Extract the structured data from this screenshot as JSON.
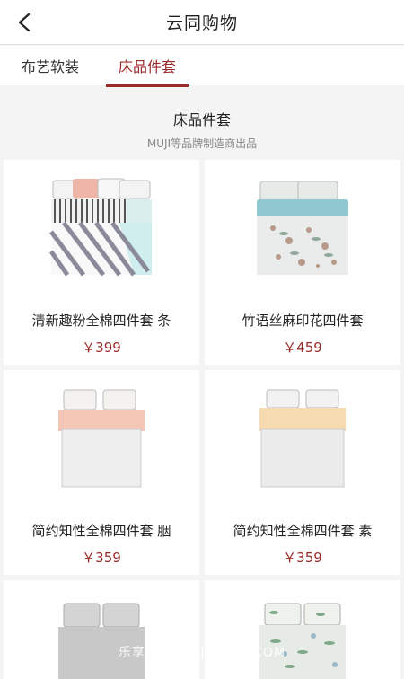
{
  "header": {
    "title": "云同购物",
    "back_icon": "back-chevron-icon"
  },
  "tabs": [
    {
      "label": "布艺软装",
      "active": false
    },
    {
      "label": "床品件套",
      "active": true
    }
  ],
  "section": {
    "title": "床品件套",
    "subtitle": "MUJI等品牌制造商出品"
  },
  "products": [
    {
      "name": "清新趣粉全棉四件套 条",
      "price": "￥399",
      "image": "bed-pink-stripes"
    },
    {
      "name": "竹语丝麻印花四件套",
      "price": "￥459",
      "image": "bed-blue-floral"
    },
    {
      "name": "简约知性全棉四件套 胭",
      "price": "￥359",
      "image": "bed-peach-white"
    },
    {
      "name": "简约知性全棉四件套 素",
      "price": "￥359",
      "image": "bed-beige-white"
    },
    {
      "name": "",
      "price": "",
      "image": "bed-grey"
    },
    {
      "name": "",
      "price": "",
      "image": "bed-green-floral"
    }
  ],
  "watermark": "乐享资汇 • NJYCQHJ.COM",
  "colors": {
    "accent": "#9b2a2a",
    "background": "#f4f4f4"
  }
}
